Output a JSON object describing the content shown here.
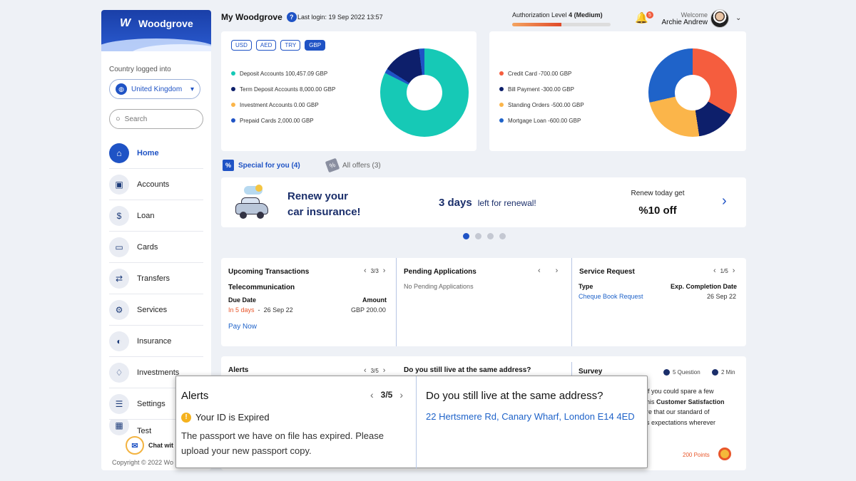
{
  "sidebar": {
    "brand": "Woodgrove",
    "country_label": "Country logged into",
    "country": "United Kingdom",
    "search_placeholder": "Search",
    "nav": [
      {
        "label": "Home",
        "icon": "home-icon"
      },
      {
        "label": "Accounts",
        "icon": "briefcase-icon"
      },
      {
        "label": "Loan",
        "icon": "loan-icon"
      },
      {
        "label": "Cards",
        "icon": "cards-icon"
      },
      {
        "label": "Transfers",
        "icon": "transfers-icon"
      },
      {
        "label": "Services",
        "icon": "services-icon"
      },
      {
        "label": "Insurance",
        "icon": "insurance-icon"
      },
      {
        "label": "Investments",
        "icon": "investments-icon"
      },
      {
        "label": "Settings",
        "icon": "settings-icon"
      },
      {
        "label": "Test",
        "icon": "test-icon"
      }
    ],
    "chat": "Chat wit",
    "copyright": "Copyright © 2022 Wo"
  },
  "header": {
    "title": "My Woodgrove",
    "last_login": "Last login: 19 Sep 2022 13:57",
    "auth_label": "Authorization Level",
    "auth_level": "4 (Medium)",
    "auth_progress": 0.5,
    "notifications": "5",
    "welcome": "Welcome",
    "user": "Archie Andrew"
  },
  "assets": {
    "currencies": [
      "USD",
      "AED",
      "TRY",
      "GBP"
    ],
    "selected_currency": "GBP",
    "legend": [
      {
        "label": "Deposit Accounts 100,457.09 GBP",
        "color": "#16c9b6"
      },
      {
        "label": "Term Deposit Accounts 8,000.00 GBP",
        "color": "#0d1f6b"
      },
      {
        "label": "Investment Accounts 0.00 GBP",
        "color": "#fbb54a"
      },
      {
        "label": "Prepaid Cards 2,000.00 GBP",
        "color": "#1f53c5"
      }
    ]
  },
  "liabilities": {
    "legend": [
      {
        "label": "Credit Card -700.00 GBP",
        "color": "#f55d3e"
      },
      {
        "label": "Bill Payment -300.00 GBP",
        "color": "#0d1f6b"
      },
      {
        "label": "Standing Orders -500.00 GBP",
        "color": "#fbb54a"
      },
      {
        "label": "Mortgage Loan -600.00 GBP",
        "color": "#1f63c9"
      }
    ]
  },
  "offers": {
    "special_tab": "Special for you (4)",
    "all_tab": "All offers (3)",
    "banner": {
      "title_line1": "Renew your",
      "title_line2": "car insurance!",
      "days": "3 days",
      "days_suffix": "left for renewal!",
      "renew_get": "Renew today get",
      "discount": "%10 off"
    }
  },
  "upcoming": {
    "title": "Upcoming Transactions",
    "pager": "3/3",
    "name": "Telecommunication",
    "due_label": "Due Date",
    "amount_label": "Amount",
    "due_in": "In 5 days",
    "sep": "-",
    "due_date": "26 Sep 22",
    "amount": "GBP 200.00",
    "action": "Pay Now"
  },
  "pending": {
    "title": "Pending Applications",
    "empty": "No Pending Applications"
  },
  "service": {
    "title": "Service Request",
    "pager": "1/5",
    "type_label": "Type",
    "exp_label": "Exp. Completion Date",
    "type": "Cheque Book Request",
    "date": "26 Sep 22"
  },
  "bottom": {
    "alerts_title": "Alerts",
    "alerts_pager": "3/5",
    "address_q": "Do you still live at the same address?",
    "survey_title": "Survey",
    "survey_questions": "5 Question",
    "survey_time": "2 Min",
    "survey_l1": "if you could spare a few",
    "survey_l2_pre": "his ",
    "survey_l2_bold": "Customer Satisfaction",
    "survey_l3": "re that our standard of",
    "survey_l4": "s expectations wherever",
    "points": "200 Points"
  },
  "zoom": {
    "title": "Alerts",
    "pager": "3/5",
    "warning": "Your ID is Expired",
    "body": "The passport we have on file has expired. Please upload your new passport copy.",
    "question": "Do you still live at the same address?",
    "address": "22 Hertsmere Rd, Canary Wharf, London E14 4ED"
  },
  "colors": {
    "primary": "#1f53c5",
    "accent": "#16c9b6",
    "alert": "#e8562a"
  }
}
